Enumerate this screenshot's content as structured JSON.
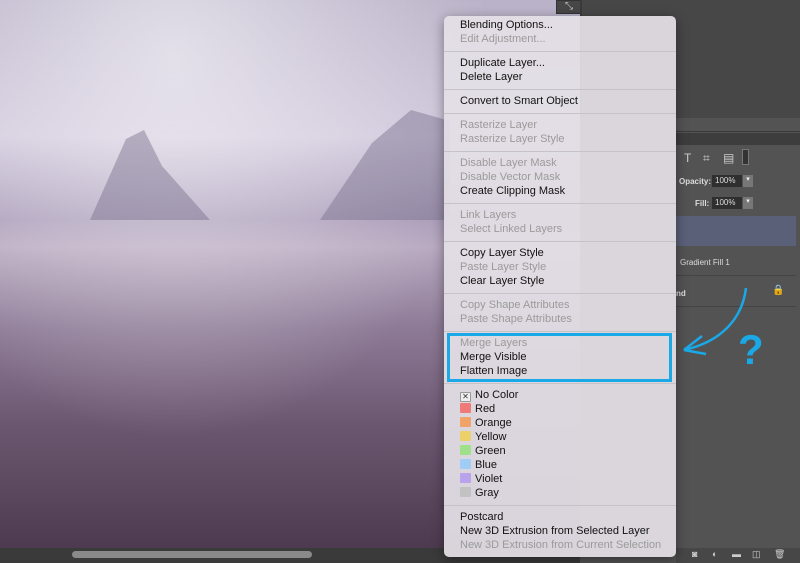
{
  "menu": {
    "groups": [
      [
        {
          "label": "Blending Options...",
          "enabled": true
        },
        {
          "label": "Edit Adjustment...",
          "enabled": false
        }
      ],
      [
        {
          "label": "Duplicate Layer...",
          "enabled": true
        },
        {
          "label": "Delete Layer",
          "enabled": true
        }
      ],
      [
        {
          "label": "Convert to Smart Object",
          "enabled": true
        }
      ],
      [
        {
          "label": "Rasterize Layer",
          "enabled": false
        },
        {
          "label": "Rasterize Layer Style",
          "enabled": false
        }
      ],
      [
        {
          "label": "Disable Layer Mask",
          "enabled": false
        },
        {
          "label": "Disable Vector Mask",
          "enabled": false
        },
        {
          "label": "Create Clipping Mask",
          "enabled": true
        }
      ],
      [
        {
          "label": "Link Layers",
          "enabled": false
        },
        {
          "label": "Select Linked Layers",
          "enabled": false
        }
      ],
      [
        {
          "label": "Copy Layer Style",
          "enabled": true
        },
        {
          "label": "Paste Layer Style",
          "enabled": false
        },
        {
          "label": "Clear Layer Style",
          "enabled": true
        }
      ],
      [
        {
          "label": "Copy Shape Attributes",
          "enabled": false
        },
        {
          "label": "Paste Shape Attributes",
          "enabled": false
        }
      ],
      [
        {
          "label": "Merge Layers",
          "enabled": false
        },
        {
          "label": "Merge Visible",
          "enabled": true
        },
        {
          "label": "Flatten Image",
          "enabled": true
        }
      ],
      [
        {
          "label": "No Color",
          "color": "none",
          "enabled": true
        },
        {
          "label": "Red",
          "color": "#ee7b78",
          "enabled": true
        },
        {
          "label": "Orange",
          "color": "#f0a46a",
          "enabled": true
        },
        {
          "label": "Yellow",
          "color": "#ecd06a",
          "enabled": true
        },
        {
          "label": "Green",
          "color": "#9fe08a",
          "enabled": true
        },
        {
          "label": "Blue",
          "color": "#9fcdf5",
          "enabled": true
        },
        {
          "label": "Violet",
          "color": "#b9a3ec",
          "enabled": true
        },
        {
          "label": "Gray",
          "color": "#c2c2c2",
          "enabled": true
        }
      ],
      [
        {
          "label": "Postcard",
          "enabled": true
        },
        {
          "label": "New 3D Extrusion from Selected Layer",
          "enabled": true
        },
        {
          "label": "New 3D Extrusion from Current Selection",
          "enabled": false
        }
      ]
    ]
  },
  "layers_panel": {
    "opacity_label": "Opacity:",
    "opacity_value": "100%",
    "fill_label": "Fill:",
    "fill_value": "100%",
    "layer_name": "Gradient Fill 1",
    "background_layer_suffix": "nd"
  },
  "annotation": {
    "question_mark": "?",
    "color": "#1aa8e6"
  }
}
